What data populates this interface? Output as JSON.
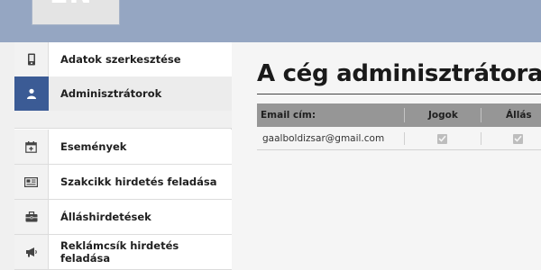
{
  "header": {
    "logo_text": "EN"
  },
  "sidebar": {
    "items": [
      {
        "label": "Adatok szerkesztése",
        "icon": "phone-icon"
      },
      {
        "label": "Adminisztrátorok",
        "icon": "user-icon",
        "active": true
      },
      {
        "label": "Események",
        "icon": "calendar-icon"
      },
      {
        "label": "Szakcikk hirdetés feladása",
        "icon": "newspaper-icon"
      },
      {
        "label": "Álláshirdetések",
        "icon": "briefcase-icon"
      },
      {
        "label": "Reklámcsík hirdetés feladása",
        "icon": "megaphone-icon"
      }
    ]
  },
  "main": {
    "title": "A cég adminisztrátorai",
    "table": {
      "headers": {
        "email": "Email cím:",
        "rights": "Jogok",
        "jobs": "Állás"
      },
      "rows": [
        {
          "email": "gaalboldizsar@gmail.com",
          "rights_checked": true,
          "jobs_checked": true
        }
      ]
    }
  },
  "colors": {
    "header_bar": "#95a6c2",
    "active_accent": "#3b5b95",
    "table_header": "#969696"
  }
}
